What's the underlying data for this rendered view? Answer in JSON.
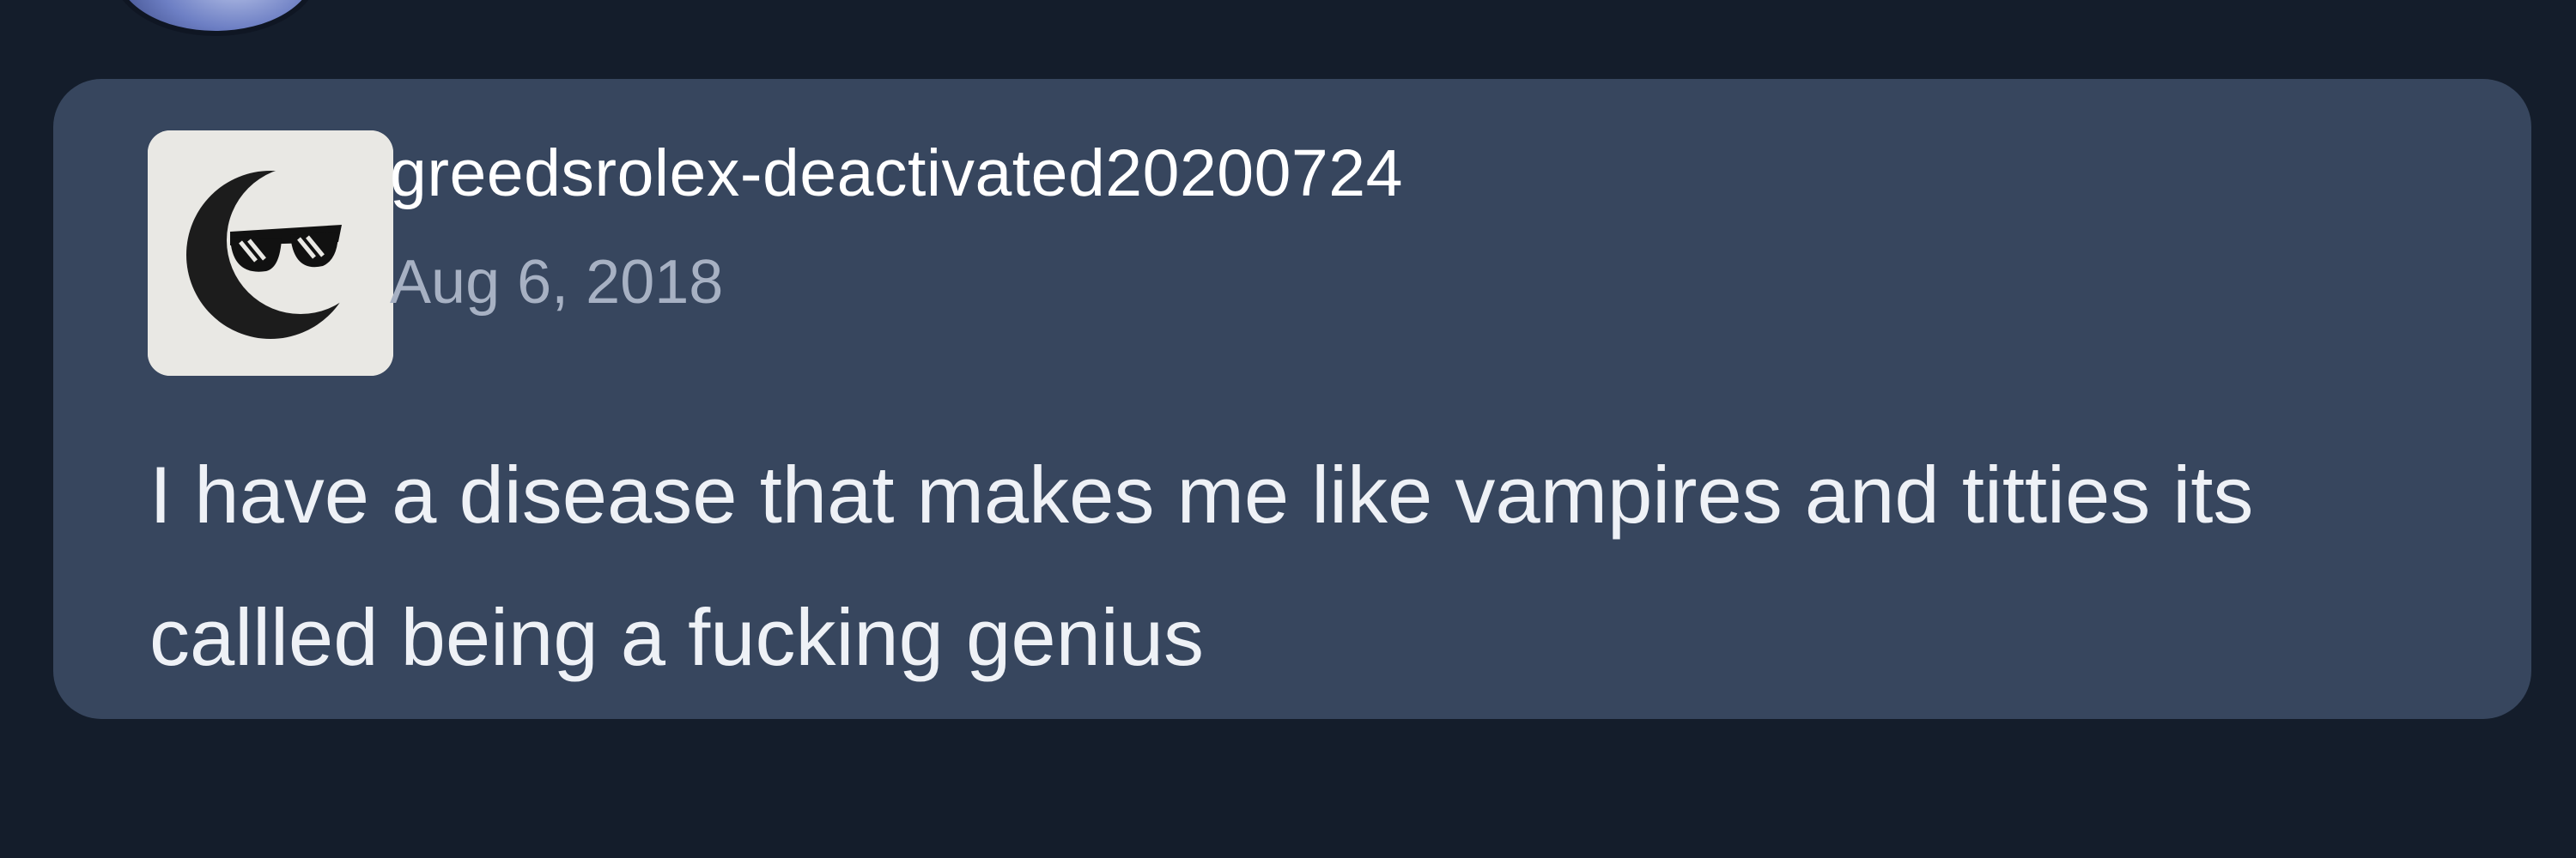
{
  "post": {
    "username": "greedsrolex-deactivated20200724",
    "date": "Aug 6, 2018",
    "body": "I have a disease that makes me like vampires and titties its callled being a fucking genius"
  },
  "colors": {
    "page_background": "#141d2b",
    "card_background": "#37465e",
    "username_text": "#ffffff",
    "date_text": "#a7b1c3",
    "body_text": "#eef1f6"
  },
  "icons": {
    "parent_avatar": "avatar-partial-icon",
    "reblog_avatar": "moon-with-sunglasses-icon"
  }
}
